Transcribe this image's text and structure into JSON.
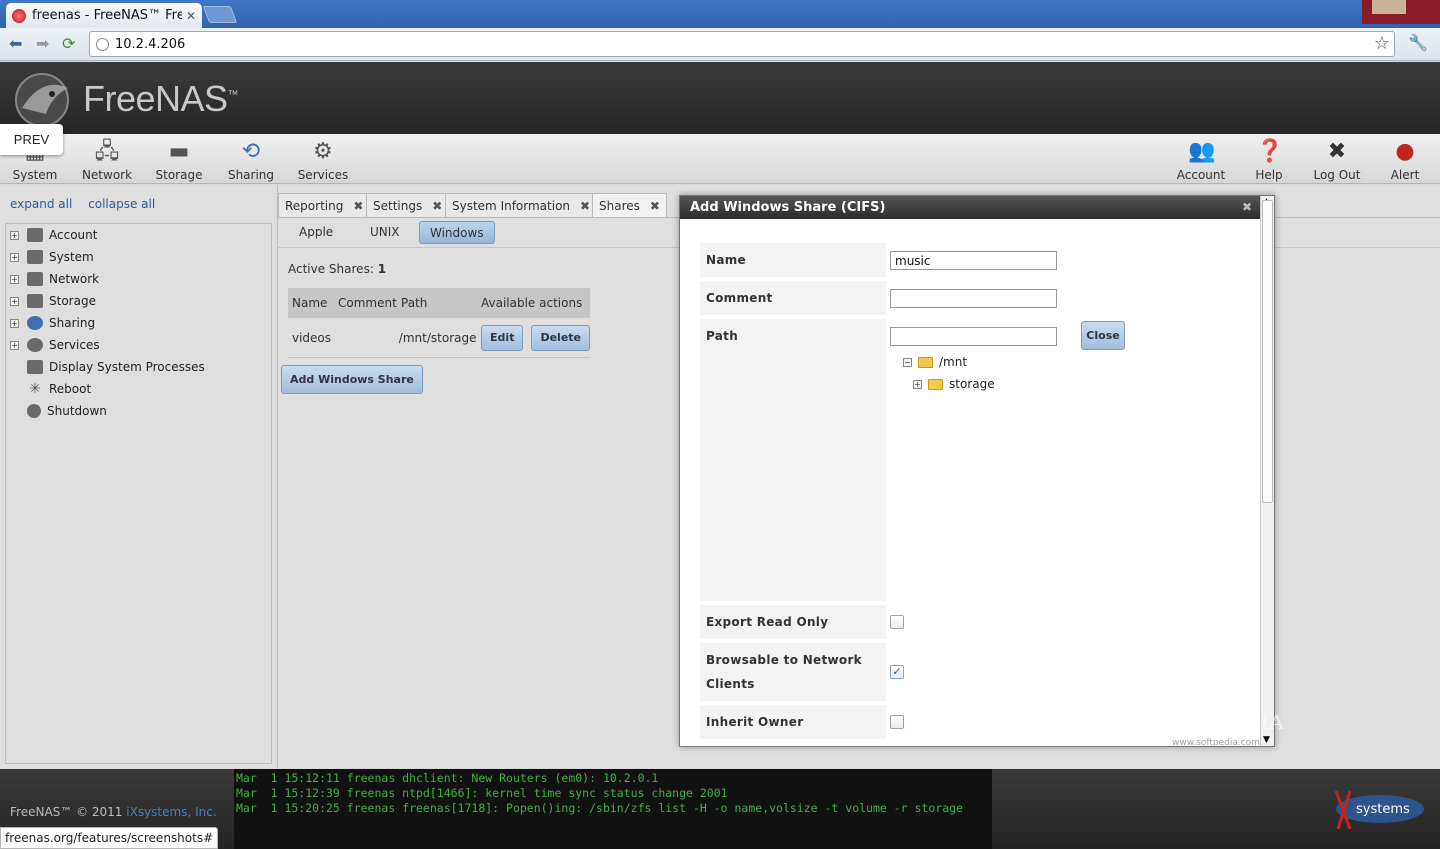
{
  "browser": {
    "tab_title": "freenas - FreeNAS™ Fre",
    "url": "10.2.4.206"
  },
  "app": {
    "brand": "FreeNAS",
    "prev_label": "PREV"
  },
  "menu": {
    "left": [
      {
        "label": "System",
        "icon": "system-icon"
      },
      {
        "label": "Network",
        "icon": "network-icon"
      },
      {
        "label": "Storage",
        "icon": "storage-icon"
      },
      {
        "label": "Sharing",
        "icon": "sharing-icon"
      },
      {
        "label": "Services",
        "icon": "services-icon"
      }
    ],
    "right": [
      {
        "label": "Account",
        "icon": "account-icon"
      },
      {
        "label": "Help",
        "icon": "help-icon"
      },
      {
        "label": "Log Out",
        "icon": "logout-icon"
      },
      {
        "label": "Alert",
        "icon": "alert-icon"
      }
    ]
  },
  "sidebar": {
    "expand_all": "expand all",
    "collapse_all": "collapse all",
    "items": [
      {
        "label": "Account",
        "expandable": "+"
      },
      {
        "label": "System",
        "expandable": "+"
      },
      {
        "label": "Network",
        "expandable": "+"
      },
      {
        "label": "Storage",
        "expandable": "+"
      },
      {
        "label": "Sharing",
        "expandable": "+"
      },
      {
        "label": "Services",
        "expandable": "+"
      },
      {
        "label": "Display System Processes",
        "expandable": ""
      },
      {
        "label": "Reboot",
        "expandable": ""
      },
      {
        "label": "Shutdown",
        "expandable": ""
      }
    ]
  },
  "tabs": [
    {
      "label": "Reporting"
    },
    {
      "label": "Settings"
    },
    {
      "label": "System Information"
    },
    {
      "label": "Shares"
    }
  ],
  "subtabs": [
    {
      "label": "Apple"
    },
    {
      "label": "UNIX"
    },
    {
      "label": "Windows"
    }
  ],
  "shares": {
    "active_label": "Active Shares:",
    "active_count": "1",
    "columns": [
      "Name",
      "Comment",
      "Path",
      "Available actions"
    ],
    "rows": [
      {
        "name": "videos",
        "comment": "",
        "path": "/mnt/storage"
      }
    ],
    "edit_label": "Edit",
    "delete_label": "Delete",
    "add_label": "Add Windows Share"
  },
  "dialog": {
    "title": "Add Windows Share (CIFS)",
    "name_label": "Name",
    "name_value": "music",
    "comment_label": "Comment",
    "comment_value": "",
    "path_label": "Path",
    "path_value": "",
    "close_label": "Close",
    "tree_root": "/mnt",
    "tree_child": "storage",
    "export_ro_label": "Export Read Only",
    "export_ro_checked": false,
    "browsable_label": "Browsable to Network Clients",
    "browsable_checked": true,
    "inherit_owner_label": "Inherit Owner",
    "inherit_owner_checked": false
  },
  "footer": {
    "copyright": "FreeNAS™ © 2011",
    "company": "iXsystems, Inc.",
    "console": [
      "Mar  1 15:12:11 freenas dhclient: New Routers (em0): 10.2.0.1",
      "Mar  1 15:12:39 freenas ntpd[1466]: kernel time sync status change 2001",
      "Mar  1 15:20:25 freenas freenas[1718]: Popen()ing: /sbin/zfs list -H -o name,volsize -t volume -r storage"
    ]
  },
  "status_url": "freenas.org/features/screenshots#",
  "watermark": "SOFTPEDIA",
  "watermark_url": "www.softpedia.com",
  "colors": {
    "header_bg": "#2b2b2b",
    "accent": "#97b6d8",
    "console_text": "#3fb03f"
  }
}
